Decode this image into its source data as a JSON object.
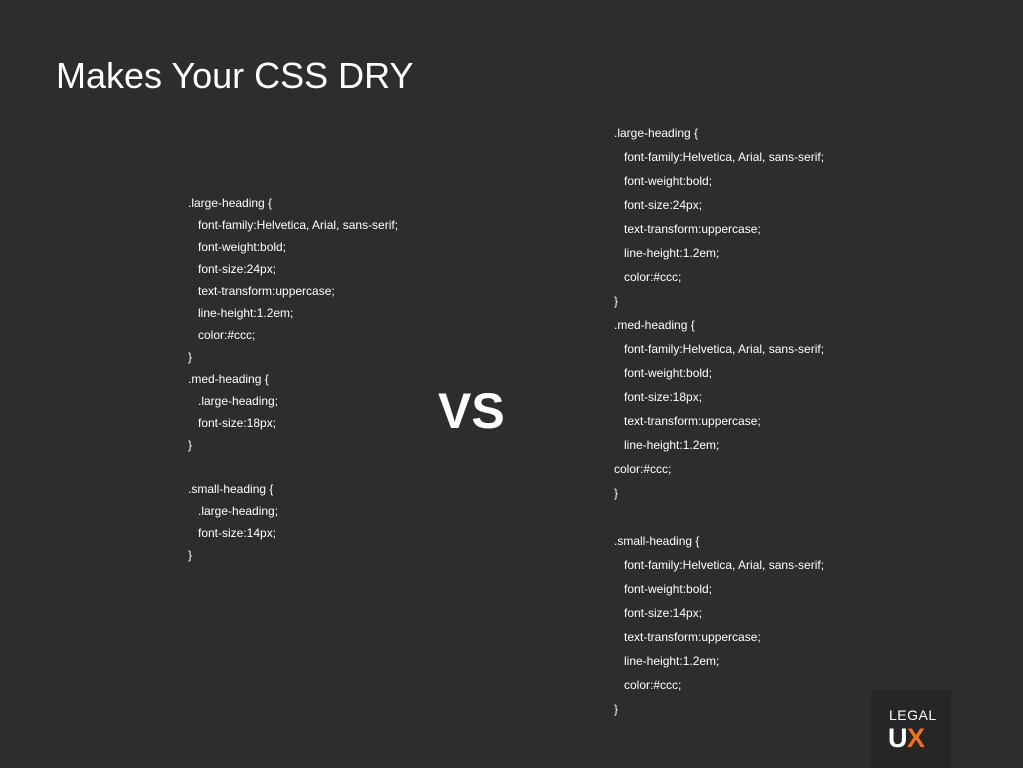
{
  "slide": {
    "title": "Makes Your CSS DRY",
    "vs_label": "VS"
  },
  "left_code": [
    {
      "text": ".large-heading {",
      "indent": false
    },
    {
      "text": "font-family:Helvetica, Arial, sans-serif;",
      "indent": true
    },
    {
      "text": "font-weight:bold;",
      "indent": true
    },
    {
      "text": "font-size:24px;",
      "indent": true
    },
    {
      "text": "text-transform:uppercase;",
      "indent": true
    },
    {
      "text": "line-height:1.2em;",
      "indent": true
    },
    {
      "text": "color:#ccc;",
      "indent": true
    },
    {
      "text": "}",
      "indent": false
    },
    {
      "text": ".med-heading {",
      "indent": false
    },
    {
      "text": ".large-heading;",
      "indent": true
    },
    {
      "text": "font-size:18px;",
      "indent": true
    },
    {
      "text": "}",
      "indent": false
    },
    {
      "text": "",
      "indent": false
    },
    {
      "text": ".small-heading {",
      "indent": false
    },
    {
      "text": ".large-heading;",
      "indent": true
    },
    {
      "text": "font-size:14px;",
      "indent": true
    },
    {
      "text": "}",
      "indent": false
    }
  ],
  "right_code": [
    {
      "text": ".large-heading {",
      "indent": false
    },
    {
      "text": "font-family:Helvetica, Arial, sans-serif;",
      "indent": true
    },
    {
      "text": "font-weight:bold;",
      "indent": true
    },
    {
      "text": "font-size:24px;",
      "indent": true
    },
    {
      "text": "text-transform:uppercase;",
      "indent": true
    },
    {
      "text": "line-height:1.2em;",
      "indent": true
    },
    {
      "text": "color:#ccc;",
      "indent": true
    },
    {
      "text": "}",
      "indent": false
    },
    {
      "text": ".med-heading {",
      "indent": false
    },
    {
      "text": "font-family:Helvetica, Arial, sans-serif;",
      "indent": true
    },
    {
      "text": "font-weight:bold;",
      "indent": true
    },
    {
      "text": "font-size:18px;",
      "indent": true
    },
    {
      "text": "text-transform:uppercase;",
      "indent": true
    },
    {
      "text": "line-height:1.2em;",
      "indent": true
    },
    {
      "text": "color:#ccc;",
      "indent": false
    },
    {
      "text": "}",
      "indent": false
    },
    {
      "text": "",
      "indent": false
    },
    {
      "text": ".small-heading {",
      "indent": false
    },
    {
      "text": "font-family:Helvetica, Arial, sans-serif;",
      "indent": true
    },
    {
      "text": "font-weight:bold;",
      "indent": true
    },
    {
      "text": "font-size:14px;",
      "indent": true
    },
    {
      "text": "text-transform:uppercase;",
      "indent": true
    },
    {
      "text": "line-height:1.2em;",
      "indent": true
    },
    {
      "text": "color:#ccc;",
      "indent": true
    },
    {
      "text": "}",
      "indent": false
    }
  ],
  "logo": {
    "top_text": "LEGAL",
    "letter_u": "U",
    "letter_x": "X",
    "accent_color": "#f37021"
  },
  "colors": {
    "background": "#2d2d2d",
    "text": "#ffffff"
  }
}
